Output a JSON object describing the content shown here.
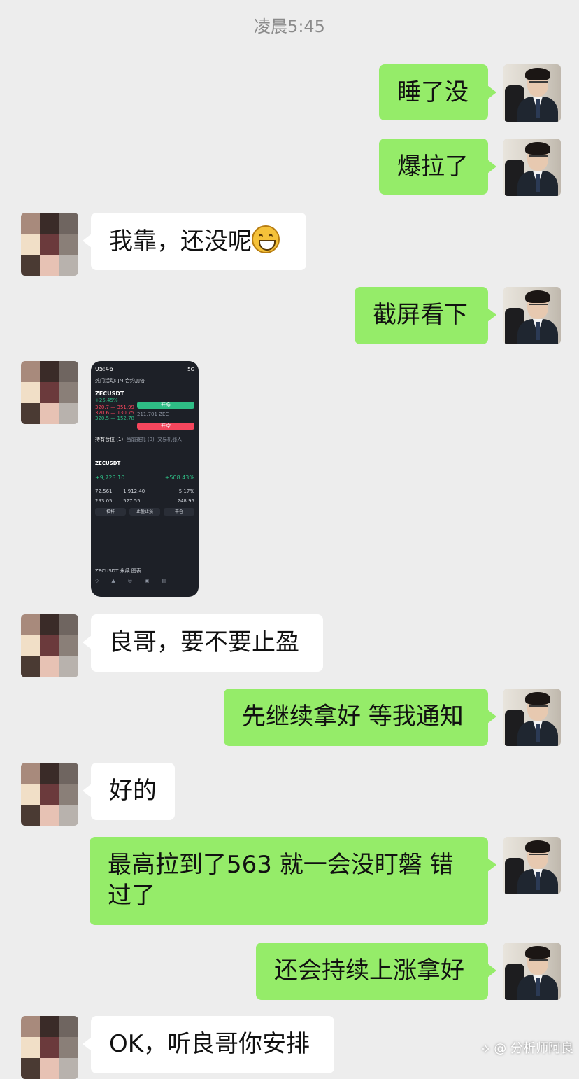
{
  "timestamp": "凌晨5:45",
  "messages": [
    {
      "text": "睡了没"
    },
    {
      "text": "爆拉了"
    },
    {
      "text": "我靠，还没呢"
    },
    {
      "text": "截屏看下"
    },
    {
      "text": "良哥，要不要止盈"
    },
    {
      "text": "先继续拿好 等我通知"
    },
    {
      "text": "好的"
    },
    {
      "text": "最高拉到了563 就一会没盯磐 错过了"
    },
    {
      "text": "还会持续上涨拿好"
    },
    {
      "text": "OK，听良哥你安排"
    }
  ],
  "screenshot": {
    "time": "05:46",
    "network": "5G",
    "notice": "热门活动: JM 合约加倍",
    "symbol": "ZECUSDT",
    "change": "+25.45%",
    "long_label": "开多",
    "short_label": "开空",
    "tabs": [
      "持有仓位 (1)",
      "当前委托 (0)",
      "交易机器人"
    ],
    "position_symbol": "ZECUSDT",
    "pnl": "+9,723.10",
    "roe": "+508.43%",
    "stat_a": "72.561",
    "stat_b": "1,912.40",
    "stat_c": "5.17%",
    "stat_d": "293.05",
    "stat_e": "527.55",
    "stat_f": "248.95",
    "buttons": [
      "杠杆",
      "止盈止损",
      "平仓"
    ],
    "footer": "ZECUSDT 永续 图表"
  },
  "watermark": "分析师阿良",
  "colors": {
    "chat_bg": "#ededed",
    "my_bubble": "#95ec69",
    "their_bubble": "#ffffff",
    "buy_green": "#2ebd85",
    "sell_red": "#f6465d"
  }
}
